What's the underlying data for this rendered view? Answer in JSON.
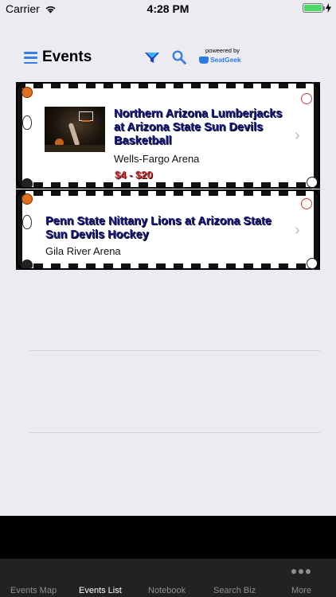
{
  "status_bar": {
    "carrier": "Carrier",
    "time": "4:28 PM"
  },
  "header": {
    "title": "Events",
    "powered_by": "poweered by",
    "brand": "SeatGeek"
  },
  "events": [
    {
      "title": "Northern Arizona Lumberjacks at Arizona State Sun Devils Basketball",
      "venue": "Wells-Fargo Arena",
      "price": "$4 - $20"
    },
    {
      "title": "Penn State Nittany Lions at Arizona State Sun Devils Hockey",
      "venue": "Gila River Arena"
    }
  ],
  "tabs": [
    {
      "label": "Events Map"
    },
    {
      "label": "Events List"
    },
    {
      "label": "Notebook"
    },
    {
      "label": "Search Biz"
    },
    {
      "label": "More"
    }
  ],
  "colors": {
    "accent": "#3b7ee0",
    "title_text": "#1a1a8a",
    "price_text": "#c63a3a",
    "background": "#ebebf1",
    "tab_bar": "#222222"
  },
  "icons": {
    "menu": "hamburger-menu-icon",
    "filter": "filter-funnel-icon",
    "search": "search-icon",
    "more": "more-dots-icon"
  }
}
